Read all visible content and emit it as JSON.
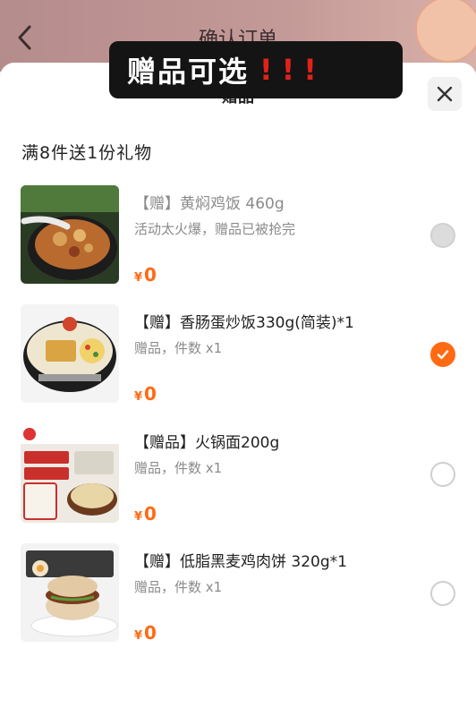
{
  "page": {
    "title": "确认订单"
  },
  "overlay": {
    "text": "赠品可选",
    "marks": "!!!"
  },
  "sheet": {
    "title": "赠品",
    "promo": "满8件送1份礼物"
  },
  "colors": {
    "accent": "#ff6a13",
    "overlay_bg": "#141414",
    "overlay_marks": "#e0221b"
  },
  "items": [
    {
      "name": "【赠】黄焖鸡饭 460g",
      "sub": "活动太火爆，赠品已被抢完",
      "currency": "¥",
      "price": "0",
      "state": "disabled"
    },
    {
      "name": "【赠】香肠蛋炒饭330g(简装)*1",
      "sub": "赠品，件数 x1",
      "currency": "¥",
      "price": "0",
      "state": "checked"
    },
    {
      "name": "【赠品】火锅面200g",
      "sub": "赠品，件数 x1",
      "currency": "¥",
      "price": "0",
      "state": "unchecked"
    },
    {
      "name": "【赠】低脂黑麦鸡肉饼 320g*1",
      "sub": "赠品，件数 x1",
      "currency": "¥",
      "price": "0",
      "state": "unchecked"
    }
  ]
}
